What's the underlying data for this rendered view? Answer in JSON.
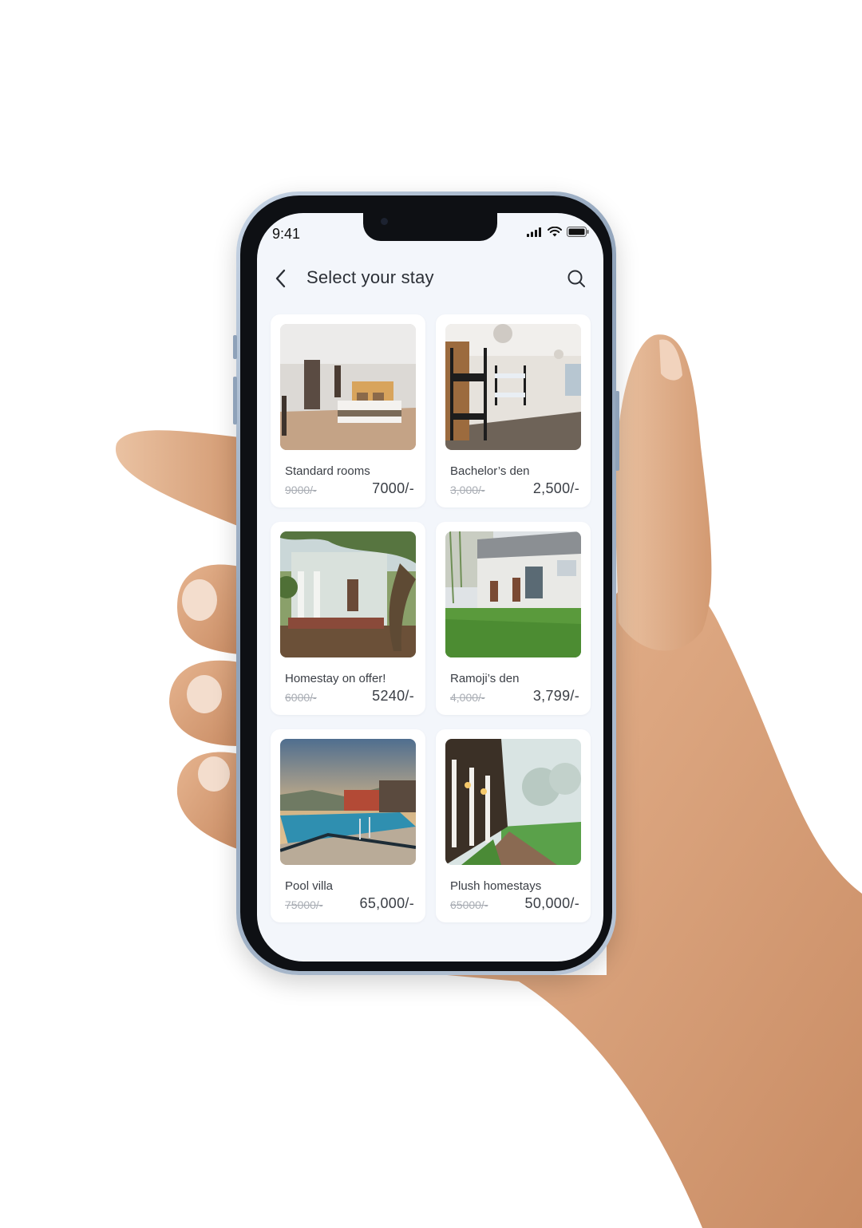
{
  "status_bar": {
    "time": "9:41"
  },
  "header": {
    "title": "Select your stay",
    "back_icon": "chevron-left-icon",
    "search_icon": "search-icon"
  },
  "listings": [
    {
      "name": "Standard rooms",
      "old_price": "9000/-",
      "price": "7000/-",
      "image": "hotel-bedroom"
    },
    {
      "name": "Bachelor’s den",
      "old_price": "3,000/-",
      "price": "2,500/-",
      "image": "bunk-bed-dorm"
    },
    {
      "name": "Homestay on offer!",
      "old_price": "6000/-",
      "price": "5240/-",
      "image": "colonial-house-tree"
    },
    {
      "name": "Ramoji’s den",
      "old_price": "4,000/-",
      "price": "3,799/-",
      "image": "courtyard-lawn"
    },
    {
      "name": "Pool villa",
      "old_price": "75000/-",
      "price": "65,000/-",
      "image": "pool-sunset"
    },
    {
      "name": "Plush homestays",
      "old_price": "65000/-",
      "price": "50,000/-",
      "image": "misty-veranda"
    }
  ],
  "colors": {
    "screen_bg": "#f3f6fb",
    "card_bg": "#ffffff",
    "title_text": "#2b2f36",
    "strike_text": "#a9adb4"
  }
}
